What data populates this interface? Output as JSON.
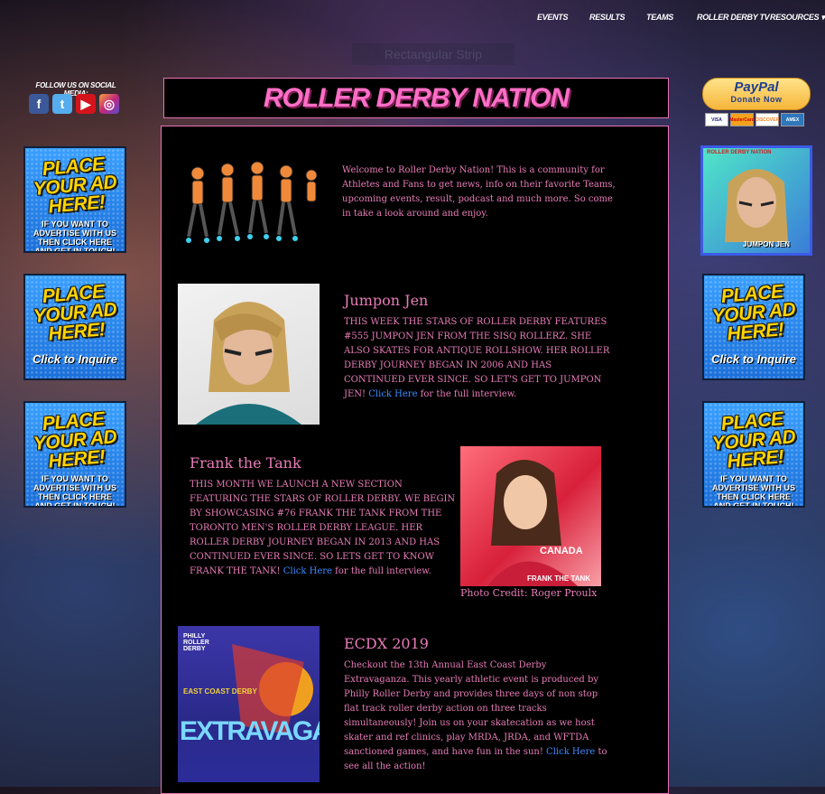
{
  "nav": [
    "EVENTS",
    "RESULTS",
    "TEAMS",
    "ROLLER DERBY TV",
    "RESOURCES ▾"
  ],
  "ghost_text": "Rectangular Strip",
  "social": {
    "label": "FOLLOW US ON SOCIAL MEDIA:",
    "icons": [
      "facebook-icon",
      "twitter-icon",
      "youtube-icon",
      "instagram-icon"
    ]
  },
  "ads": {
    "big": "PLACE YOUR AD HERE!",
    "small": "IF YOU WANT TO ADVERTISE WITH US THEN CLICK HERE AND GET IN TOUCH!",
    "inquire": "Click to Inquire"
  },
  "site_title": "ROLLER DERBY NATION",
  "welcome": "Welcome to Roller Derby Nation! This is a community for Athletes and Fans to get news, info on their favorite Teams, upcoming events, result, podcast and much more. So come in take a look around and enjoy.",
  "articles": [
    {
      "title": "Jumpon Jen",
      "body": "THIS WEEK THE STARS OF ROLLER DERBY FEATURES #555 JUMPON JEN FROM THE SISQ ROLLERZ. SHE ALSO SKATES FOR ANTIQUE ROLLSHOW. HER ROLLER DERBY JOURNEY BEGAN IN 2006 AND HAS CONTINUED EVER SINCE. SO LET'S GET TO JUMPON JEN!",
      "link": "Click Here",
      "after": " for the full interview."
    },
    {
      "title": "Frank the Tank",
      "body": "THIS MONTH WE LAUNCH A NEW SECTION FEATURING THE STARS OF ROLLER DERBY. WE BEGIN BY SHOWCASING #76 FRANK THE TANK FROM THE TORONTO MEN'S ROLLER DERBY LEAGUE. HER ROLLER DERBY JOURNEY BEGAN IN 2013 AND HAS CONTINUED EVER SINCE. SO LETS GET TO KNOW FRANK THE TANK!",
      "link": "Click Here",
      "after": " for the full interview.",
      "caption": "Photo Credit: Roger Proulx",
      "image_label": "FRANK THE TANK",
      "image_tag": "CANADA"
    },
    {
      "title": "ECDX 2019",
      "body": "Checkout the 13th Annual East Coast Derby Extravaganza. This yearly athletic event is produced by Philly Roller Derby and provides three days of non stop flat track roller derby action on three tracks simultaneously! Join us on your skatecation as we host skater and ref clinics, play MRDA, JRDA, and WFTDA sanctioned games, and have fun in the sun!",
      "link": "Click Here",
      "after": " to see all the action!",
      "poster_top": "PHILLY ROLLER DERBY",
      "poster_mid": "EAST COAST DERBY",
      "poster_big": "EXTRAVAGANZA"
    }
  ],
  "paypal": {
    "brand": "PayPal",
    "action": "Donate Now"
  },
  "cards": [
    "VISA",
    "MasterCard",
    "DISCOVER",
    "AMEX"
  ],
  "trade_card": {
    "top": "ROLLER DERBY NATION",
    "name": "JUMPON JEN"
  }
}
